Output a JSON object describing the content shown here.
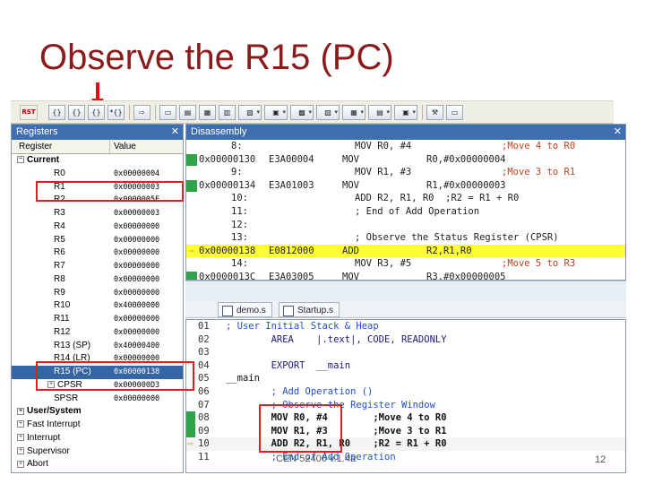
{
  "slide": {
    "title": "Observe the R15 (PC)",
    "footer": "CEN 52400 v.1.4a",
    "page": "12"
  },
  "toolbar": {
    "rst_label": "RST",
    "buttons": [
      "step-into",
      "step-over",
      "step-out",
      "run-to-cursor",
      "show-next",
      "command",
      "disassembly",
      "symbols",
      "registers",
      "call-stack",
      "watch",
      "memory",
      "serial",
      "analysis",
      "trace",
      "system-viewer",
      "toolbox",
      "options"
    ]
  },
  "registers": {
    "title": "Registers",
    "close": "✕",
    "col_register": "Register",
    "col_value": "Value",
    "rows": [
      {
        "name": "Current",
        "value": "",
        "group": true,
        "indent": 1,
        "exp": "−"
      },
      {
        "name": "R0",
        "value": "0x00000004",
        "indent": 2
      },
      {
        "name": "R1",
        "value": "0x00000003",
        "indent": 2
      },
      {
        "name": "R2",
        "value": "0x0000005E",
        "indent": 2
      },
      {
        "name": "R3",
        "value": "0x00000003",
        "indent": 2
      },
      {
        "name": "R4",
        "value": "0x00000000",
        "indent": 2
      },
      {
        "name": "R5",
        "value": "0x00000000",
        "indent": 2
      },
      {
        "name": "R6",
        "value": "0x00000000",
        "indent": 2
      },
      {
        "name": "R7",
        "value": "0x00000000",
        "indent": 2
      },
      {
        "name": "R8",
        "value": "0x00000000",
        "indent": 2
      },
      {
        "name": "R9",
        "value": "0x00000000",
        "indent": 2
      },
      {
        "name": "R10",
        "value": "0x40000000",
        "indent": 2
      },
      {
        "name": "R11",
        "value": "0x00000000",
        "indent": 2
      },
      {
        "name": "R12",
        "value": "0x00000000",
        "indent": 2
      },
      {
        "name": "R13 (SP)",
        "value": "0x40000400",
        "indent": 2
      },
      {
        "name": "R14 (LR)",
        "value": "0x00000000",
        "indent": 2
      },
      {
        "name": "R15 (PC)",
        "value": "0x00000138",
        "indent": 2,
        "selected": true
      },
      {
        "name": "CPSR",
        "value": "0x000000D3",
        "indent": 2,
        "exp": "+"
      },
      {
        "name": "SPSR",
        "value": "0x00000000",
        "indent": 2
      },
      {
        "name": "User/System",
        "value": "",
        "group": true,
        "indent": 1,
        "exp": "+"
      },
      {
        "name": "Fast Interrupt",
        "value": "",
        "indent": 1,
        "exp": "+"
      },
      {
        "name": "Interrupt",
        "value": "",
        "indent": 1,
        "exp": "+"
      },
      {
        "name": "Supervisor",
        "value": "",
        "indent": 1,
        "exp": "+"
      },
      {
        "name": "Abort",
        "value": "",
        "indent": 1,
        "exp": "+"
      }
    ]
  },
  "disassembly": {
    "title": "Disassembly",
    "close": "✕",
    "lines": [
      {
        "kind": "src",
        "num": "8:",
        "code": "MOV R0, #4",
        "comment": ";Move 4 to R0"
      },
      {
        "kind": "asm",
        "gutter": true,
        "addr": "0x00000130",
        "hex": "E3A00004",
        "mn": "MOV",
        "ops": "R0,#0x00000004"
      },
      {
        "kind": "src",
        "num": "9:",
        "code": "MOV R1, #3",
        "comment": ";Move 3 to R1"
      },
      {
        "kind": "asm",
        "gutter": true,
        "addr": "0x00000134",
        "hex": "E3A01003",
        "mn": "MOV",
        "ops": "R1,#0x00000003"
      },
      {
        "kind": "src",
        "num": "10:",
        "code": "ADD R2, R1, R0  ;R2 = R1 + R0",
        "comment": ""
      },
      {
        "kind": "src",
        "num": "11:",
        "code": "; End of Add Operation",
        "comment": ""
      },
      {
        "kind": "src",
        "num": "12:",
        "code": "",
        "comment": ""
      },
      {
        "kind": "src",
        "num": "13:",
        "code": "; Observe the Status Register (CPSR)",
        "comment": ""
      },
      {
        "kind": "asm",
        "highlight": true,
        "pointer": true,
        "addr": "0x00000138",
        "hex": "E0812000",
        "mn": "ADD",
        "ops": "R2,R1,R0"
      },
      {
        "kind": "src",
        "num": "14:",
        "code": "MOV R3, #5",
        "comment": ";Move 5 to R3"
      },
      {
        "kind": "asm",
        "gutter": true,
        "addr": "0x0000013C",
        "hex": "E3A03005",
        "mn": "MOV",
        "ops": "R3,#0x00000005"
      }
    ]
  },
  "tabs": [
    "demo.s",
    "Startup.s"
  ],
  "editor": {
    "lines": [
      {
        "ln": "01",
        "code": "; User Initial Stack & Heap",
        "cls": "cm"
      },
      {
        "ln": "02",
        "code": "        AREA    |.text|, CODE, READONLY",
        "cls": "kw"
      },
      {
        "ln": "03",
        "code": "",
        "cls": ""
      },
      {
        "ln": "04",
        "code": "        EXPORT  __main",
        "cls": "kw"
      },
      {
        "ln": "05",
        "code": "__main",
        "cls": ""
      },
      {
        "ln": "06",
        "code": "        ; Add Operation ()",
        "cls": "cm"
      },
      {
        "ln": "07",
        "code": "        ; Observe the Register Window",
        "cls": "cm"
      },
      {
        "ln": "08",
        "code": "        MOV R0, #4        ;Move 4 to R0",
        "cls": "bold",
        "gutter": true
      },
      {
        "ln": "09",
        "code": "        MOV R1, #3        ;Move 3 to R1",
        "cls": "bold",
        "gutter": true
      },
      {
        "ln": "10",
        "code": "        ADD R2, R1, R0    ;R2 = R1 + R0",
        "cls": "bold",
        "pointer": true
      },
      {
        "ln": "11",
        "code": "        ; End of Add Operation",
        "cls": "cm"
      }
    ]
  },
  "colors": {
    "title": "#8b1a1a",
    "highlight_box": "#e02020",
    "pc_line": "#ffff33",
    "gutter": "#2fa34a",
    "selection": "#3565a5"
  }
}
